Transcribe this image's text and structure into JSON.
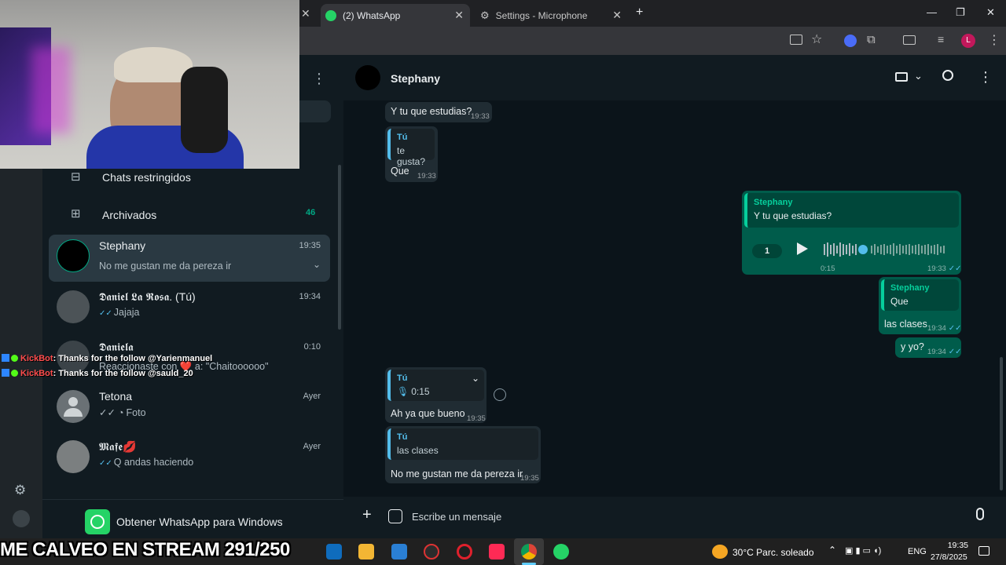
{
  "browser": {
    "tabs": [
      {
        "label": "(2) WhatsApp"
      },
      {
        "label": "Settings - Microphone"
      }
    ],
    "profile_initial": "L"
  },
  "left_menu": {
    "restricted": "Chats restringidos",
    "archived": "Archivados",
    "archived_count": "46"
  },
  "chats": [
    {
      "name": "Stephany",
      "time": "19:35",
      "preview": "No me gustan me da pereza ir"
    },
    {
      "name": "𝕯𝖆𝖓𝖎𝖊𝖑 𝕷𝖆 𝕽𝖔𝖘𝖆. (Tú)",
      "time": "19:34",
      "preview": "Jajaja"
    },
    {
      "name": "𝕯𝖆𝖓𝖎𝖊𝖑𝖆",
      "time": "0:10",
      "preview": "Reaccionaste con ❤️ a: \"Chaitoooooo\""
    },
    {
      "name": "Tetona",
      "time": "Ayer",
      "preview": "Foto"
    },
    {
      "name": "𝕸𝖆𝖋𝖊💋",
      "time": "Ayer",
      "preview": "Q andas haciendo"
    }
  ],
  "get_app": "Obtener WhatsApp para Windows",
  "conversation": {
    "contact": "Stephany",
    "m1_text": "Y tu que estudias?",
    "m1_time": "19:33",
    "m2_qname": "Tú",
    "m2_qtext": "te gusta?",
    "m2_text": "Que",
    "m2_time": "19:33",
    "m3_qname": "Stephany",
    "m3_qtext": "Y tu que estudias?",
    "m3_speed": "1",
    "m3_duration": "0:15",
    "m3_time": "19:33",
    "m4_qname": "Stephany",
    "m4_qtext": "Que",
    "m4_text": "las clases",
    "m4_time": "19:34",
    "m5_text": "y yo?",
    "m5_time": "19:34",
    "m6_qname": "Tú",
    "m6_qtext": "0:15",
    "m6_text": "Ah ya que bueno",
    "m6_time": "19:35",
    "m7_qname": "Tú",
    "m7_qtext": "las clases",
    "m7_text": "No me gustan me da pereza ir",
    "m7_time": "19:35",
    "composer_placeholder": "Escribe un mensaje"
  },
  "kick_chat": [
    {
      "user": "KickBot",
      "text": ": Thanks for the follow @Yarienmanuel"
    },
    {
      "user": "KickBot",
      "text": ": Thanks for the follow @sauld_20"
    }
  ],
  "stream_banner": "ME CALVEO EN STREAM 291/250",
  "taskbar": {
    "weather": "30°C  Parc. soleado",
    "lang": "ENG",
    "time": "19:35",
    "date": "27/8/2025"
  },
  "colors": {
    "accent": "#00a884",
    "outgoing": "#005c4b",
    "incoming": "#202c33",
    "ticks": "#53bdeb"
  }
}
